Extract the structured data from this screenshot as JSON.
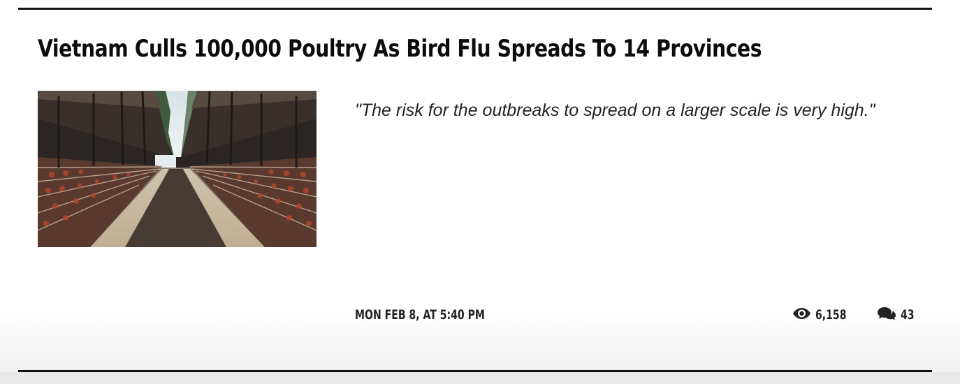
{
  "article": {
    "title": "Vietnam Culls 100,000 Poultry As Bird Flu Spreads To 14 Provinces",
    "excerpt": "\"The risk for the outbreaks to spread on a larger scale is very high.\"",
    "date": "MON FEB 8, AT 5:40 PM",
    "views": "6,158",
    "comments": "43",
    "thumbnail_icon": "poultry-farm-photo"
  },
  "icons": {
    "views": "eye-icon",
    "comments": "comments-icon"
  },
  "colors": {
    "text": "#111111",
    "rule": "#111111",
    "background": "#ffffff"
  }
}
